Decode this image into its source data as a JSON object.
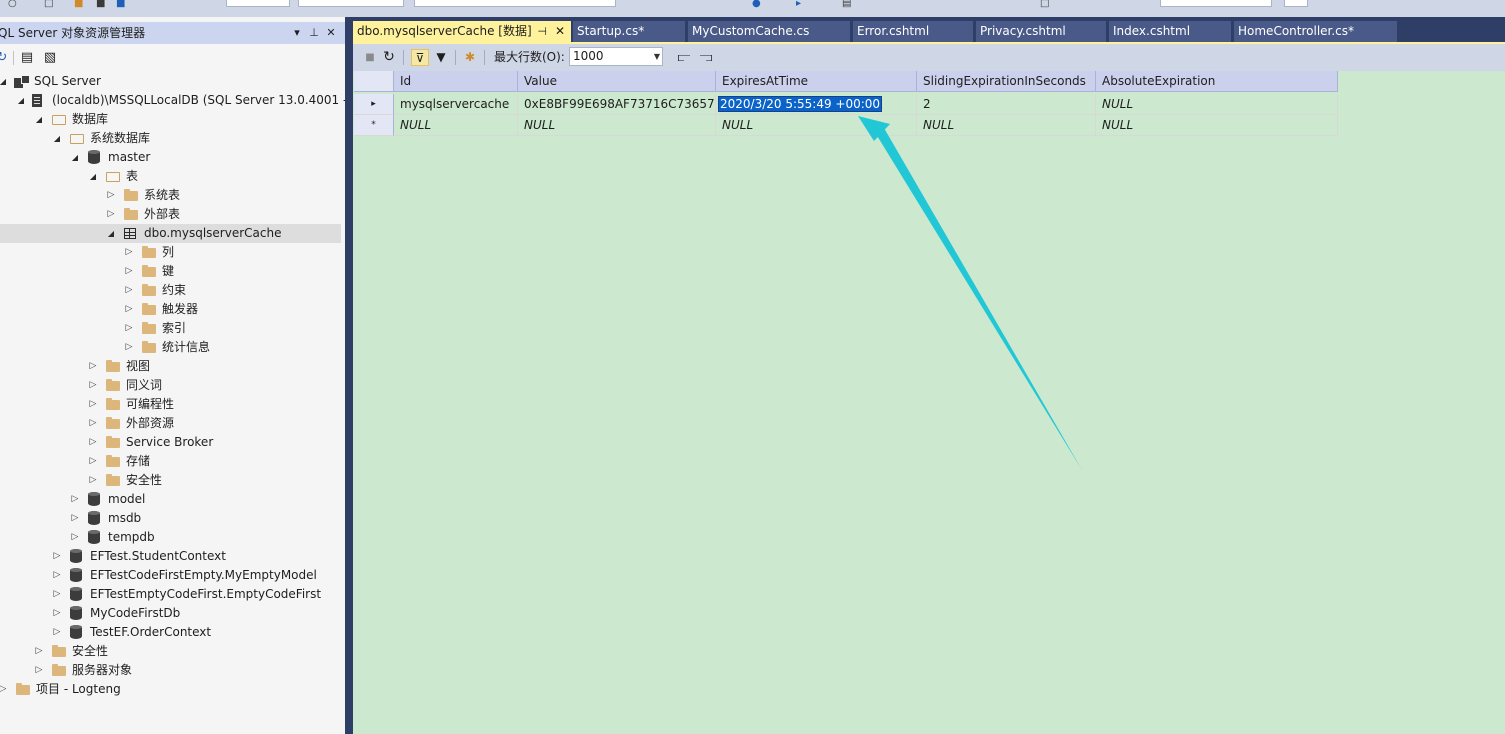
{
  "object_explorer": {
    "title": "QL Server 对象资源管理器",
    "title_buttons": [
      "▾",
      "⊥",
      "✕"
    ],
    "tree": [
      {
        "label": "SQL Server",
        "icon": "sql-server-icon",
        "expanded": true
      },
      {
        "label": "(localdb)\\MSSQLLocalDB (SQL Server 13.0.4001 -",
        "icon": "server-icon",
        "expanded": true
      },
      {
        "label": "数据库",
        "icon": "folder-open-icon",
        "expanded": true
      },
      {
        "label": "系统数据库",
        "icon": "folder-open-icon",
        "expanded": true
      },
      {
        "label": "master",
        "icon": "database-icon",
        "expanded": true
      },
      {
        "label": "表",
        "icon": "folder-open-icon",
        "expanded": true
      },
      {
        "label": "系统表",
        "icon": "folder-icon",
        "expanded": false
      },
      {
        "label": "外部表",
        "icon": "folder-icon",
        "expanded": false
      },
      {
        "label": "dbo.mysqlserverCache",
        "icon": "table-icon",
        "expanded": true
      },
      {
        "label": "列",
        "icon": "folder-icon",
        "expanded": false
      },
      {
        "label": "键",
        "icon": "folder-icon",
        "expanded": false
      },
      {
        "label": "约束",
        "icon": "folder-icon",
        "expanded": false
      },
      {
        "label": "触发器",
        "icon": "folder-icon",
        "expanded": false
      },
      {
        "label": "索引",
        "icon": "folder-icon",
        "expanded": false
      },
      {
        "label": "统计信息",
        "icon": "folder-icon",
        "expanded": false
      },
      {
        "label": "视图",
        "icon": "folder-icon",
        "expanded": false
      },
      {
        "label": "同义词",
        "icon": "folder-icon",
        "expanded": false
      },
      {
        "label": "可编程性",
        "icon": "folder-icon",
        "expanded": false
      },
      {
        "label": "外部资源",
        "icon": "folder-icon",
        "expanded": false
      },
      {
        "label": "Service Broker",
        "icon": "folder-icon",
        "expanded": false
      },
      {
        "label": "存储",
        "icon": "folder-icon",
        "expanded": false
      },
      {
        "label": "安全性",
        "icon": "folder-icon",
        "expanded": false
      },
      {
        "label": "model",
        "icon": "database-icon",
        "expanded": false
      },
      {
        "label": "msdb",
        "icon": "database-icon",
        "expanded": false
      },
      {
        "label": "tempdb",
        "icon": "database-icon",
        "expanded": false
      },
      {
        "label": "EFTest.StudentContext",
        "icon": "database-icon",
        "expanded": false
      },
      {
        "label": "EFTestCodeFirstEmpty.MyEmptyModel",
        "icon": "database-icon",
        "expanded": false
      },
      {
        "label": "EFTestEmptyCodeFirst.EmptyCodeFirst",
        "icon": "database-icon",
        "expanded": false
      },
      {
        "label": "MyCodeFirstDb",
        "icon": "database-icon",
        "expanded": false
      },
      {
        "label": "TestEF.OrderContext",
        "icon": "database-icon",
        "expanded": false
      },
      {
        "label": "安全性",
        "icon": "folder-icon",
        "expanded": false
      },
      {
        "label": "服务器对象",
        "icon": "folder-icon",
        "expanded": false
      },
      {
        "label": "项目 - Logteng",
        "icon": "folder-icon",
        "expanded": false
      }
    ]
  },
  "tabs": [
    {
      "label": "dbo.mysqlserverCache [数据]",
      "active": true
    },
    {
      "label": "Startup.cs*",
      "active": false
    },
    {
      "label": "MyCustomCache.cs",
      "active": false
    },
    {
      "label": "Error.cshtml",
      "active": false
    },
    {
      "label": "Privacy.cshtml",
      "active": false
    },
    {
      "label": "Index.cshtml",
      "active": false
    },
    {
      "label": "HomeController.cs*",
      "active": false
    }
  ],
  "grid_toolbar": {
    "max_rows_label": "最大行数(O):",
    "max_rows_value": "1000"
  },
  "grid": {
    "columns": [
      "Id",
      "Value",
      "ExpiresAtTime",
      "SlidingExpirationInSeconds",
      "AbsoluteExpiration"
    ],
    "rows": [
      {
        "marker": "▸",
        "cells": [
          "mysqlservercache",
          "0xE8BF99E698AF73716C73657...",
          "2020/3/20 5:55:49 +00:00",
          "2",
          "NULL"
        ]
      },
      {
        "marker": "*",
        "cells": [
          "NULL",
          "NULL",
          "NULL",
          "NULL",
          "NULL"
        ]
      }
    ]
  },
  "colors": {
    "accent_tab": "#fff29d",
    "tabstrip": "#2e3e67",
    "grid_background": "#cce8cf",
    "annotation_arrow": "#22c7d6",
    "selection": "#0a63c8"
  }
}
